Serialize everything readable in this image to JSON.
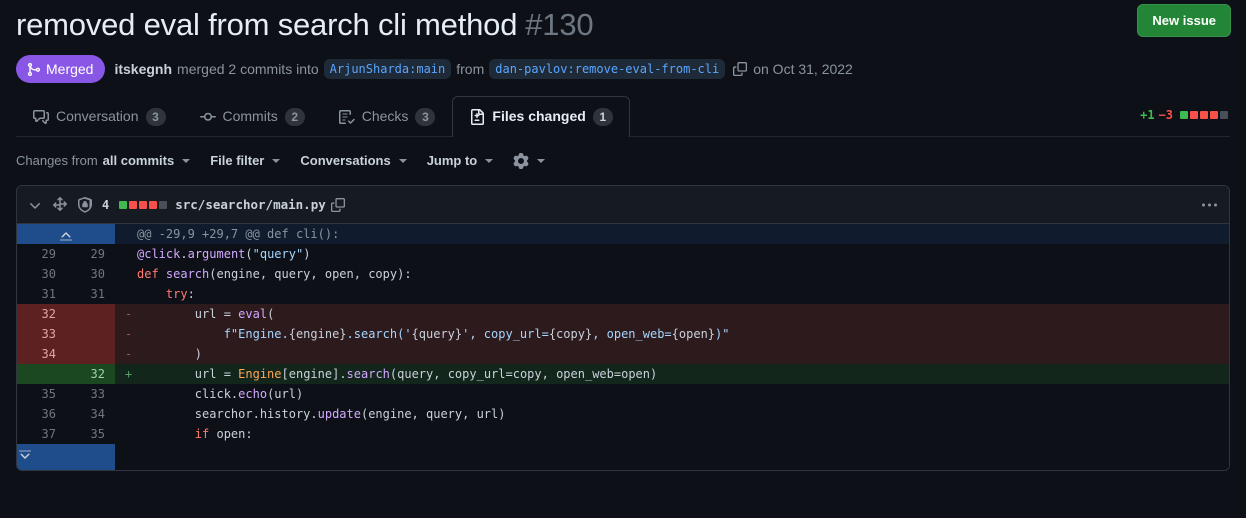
{
  "header": {
    "title": "removed eval from search cli method",
    "number": "#130",
    "new_issue_label": "New issue",
    "state_badge": "Merged",
    "state_icon": "git-merge-icon",
    "state_color": "#8957e5",
    "author": "itskegnh",
    "merge_text": "merged 2 commits into",
    "base_branch": "ArjunSharda:main",
    "from_label": "from",
    "head_branch": "dan-pavlov:remove-eval-from-cli",
    "copy_icon": "copy-icon",
    "date": "on Oct 31, 2022"
  },
  "tabs": [
    {
      "label": "Conversation",
      "count": "3",
      "icon": "comment-discussion-icon",
      "active": false
    },
    {
      "label": "Commits",
      "count": "2",
      "icon": "git-commit-icon",
      "active": false
    },
    {
      "label": "Checks",
      "count": "3",
      "icon": "checklist-icon",
      "active": false
    },
    {
      "label": "Files changed",
      "count": "1",
      "icon": "file-diff-icon",
      "active": true
    }
  ],
  "diffstat": {
    "additions": "+1",
    "deletions": "−3",
    "squares": [
      "#3fb950",
      "#f85149",
      "#f85149",
      "#f85149",
      "#484f58"
    ]
  },
  "toolbar": {
    "changes_from_prefix": "Changes from",
    "changes_from_value": "all commits",
    "file_filter": "File filter",
    "conversations": "Conversations",
    "jump_to": "Jump to",
    "gear_icon": "gear-icon"
  },
  "file": {
    "chevron_icon": "chevron-down-icon",
    "move_icon": "move-to-icon",
    "shield_icon": "shield-lock-icon",
    "change_count": "4",
    "squares": [
      "#3fb950",
      "#f85149",
      "#f85149",
      "#f85149",
      "#484f58"
    ],
    "name": "src/searchor/main.py",
    "copy_icon": "copy-path-icon",
    "menu_icon": "kebab-horizontal-icon"
  },
  "diff": {
    "expand_up_icon": "expand-up-icon",
    "expand_down_icon": "expand-down-icon",
    "hunk_header": "@@ -29,9 +29,7 @@ def cli():",
    "rows": [
      {
        "type": "ctx",
        "old": "29",
        "new": "29",
        "marker": "",
        "tokens": [
          {
            "t": "@click",
            "c": "dec"
          },
          {
            "t": ".",
            "c": "pm"
          },
          {
            "t": "argument",
            "c": "dec"
          },
          {
            "t": "(",
            "c": "pm"
          },
          {
            "t": "\"query\"",
            "c": "st"
          },
          {
            "t": ")",
            "c": "pm"
          }
        ]
      },
      {
        "type": "ctx",
        "old": "30",
        "new": "30",
        "marker": "",
        "tokens": [
          {
            "t": "def ",
            "c": "k"
          },
          {
            "t": "search",
            "c": "fn"
          },
          {
            "t": "(engine, query, open, copy):",
            "c": "pm"
          }
        ]
      },
      {
        "type": "ctx",
        "old": "31",
        "new": "31",
        "marker": "",
        "tokens": [
          {
            "t": "    ",
            "c": "pm"
          },
          {
            "t": "try",
            "c": "k"
          },
          {
            "t": ":",
            "c": "pm"
          }
        ]
      },
      {
        "type": "del",
        "old": "32",
        "new": "",
        "marker": "-",
        "tokens": [
          {
            "t": "        url = ",
            "c": "pm"
          },
          {
            "t": "eval",
            "c": "fn"
          },
          {
            "t": "(",
            "c": "pm"
          }
        ]
      },
      {
        "type": "del",
        "old": "33",
        "new": "",
        "marker": "-",
        "tokens": [
          {
            "t": "            f\"Engine.",
            "c": "st"
          },
          {
            "t": "{engine}",
            "c": "id"
          },
          {
            "t": ".search('",
            "c": "st"
          },
          {
            "t": "{query}",
            "c": "id"
          },
          {
            "t": "', copy_url=",
            "c": "st"
          },
          {
            "t": "{copy}",
            "c": "id"
          },
          {
            "t": ", open_web=",
            "c": "st"
          },
          {
            "t": "{open}",
            "c": "id"
          },
          {
            "t": ")\"",
            "c": "st"
          }
        ]
      },
      {
        "type": "del",
        "old": "34",
        "new": "",
        "marker": "-",
        "tokens": [
          {
            "t": "        )",
            "c": "pm"
          }
        ]
      },
      {
        "type": "add",
        "old": "",
        "new": "32",
        "marker": "+",
        "tokens": [
          {
            "t": "        url = ",
            "c": "pm"
          },
          {
            "t": "Engine",
            "c": "cn"
          },
          {
            "t": "[engine].",
            "c": "pm"
          },
          {
            "t": "search",
            "c": "fn"
          },
          {
            "t": "(query, copy_url=copy, open_web=open)",
            "c": "pm"
          }
        ]
      },
      {
        "type": "ctx",
        "old": "35",
        "new": "33",
        "marker": "",
        "tokens": [
          {
            "t": "        click.",
            "c": "pm"
          },
          {
            "t": "echo",
            "c": "fn"
          },
          {
            "t": "(url)",
            "c": "pm"
          }
        ]
      },
      {
        "type": "ctx",
        "old": "36",
        "new": "34",
        "marker": "",
        "tokens": [
          {
            "t": "        searchor.history.",
            "c": "pm"
          },
          {
            "t": "update",
            "c": "fn"
          },
          {
            "t": "(engine, query, url)",
            "c": "pm"
          }
        ]
      },
      {
        "type": "ctx",
        "old": "37",
        "new": "35",
        "marker": "",
        "tokens": [
          {
            "t": "        ",
            "c": "pm"
          },
          {
            "t": "if",
            "c": "k"
          },
          {
            "t": " open:",
            "c": "pm"
          }
        ]
      }
    ]
  }
}
